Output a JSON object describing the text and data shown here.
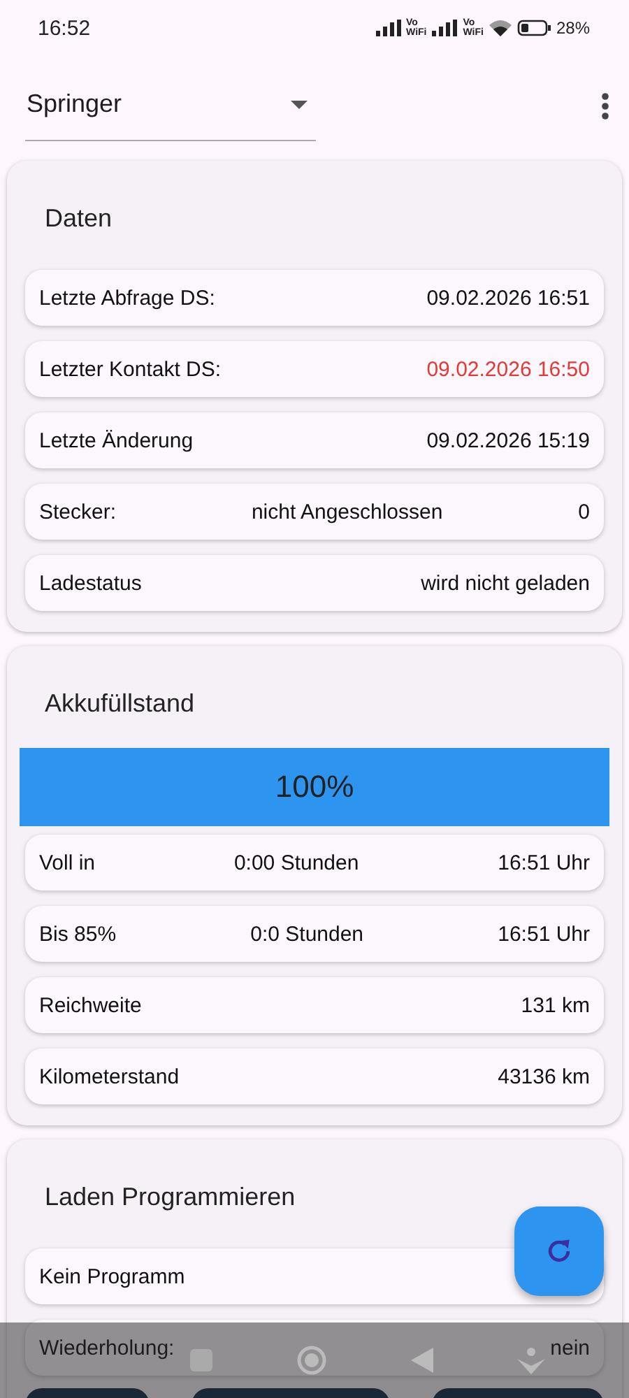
{
  "status_bar": {
    "time": "16:52",
    "network_labels": [
      {
        "top": "Vo",
        "bottom": "WiFi"
      },
      {
        "top": "Vo",
        "bottom": "WiFi"
      }
    ],
    "battery": "28%"
  },
  "header": {
    "vehicle": "Springer"
  },
  "data_card": {
    "title": "Daten",
    "rows": [
      {
        "label": "Letzte Abfrage DS:",
        "value": "09.02.2026 16:51",
        "alert": false
      },
      {
        "label": "Letzter Kontakt DS:",
        "value": "09.02.2026 16:50",
        "alert": true
      },
      {
        "label": "Letzte Änderung",
        "value": "09.02.2026 15:19",
        "alert": false
      },
      {
        "label": "Stecker:",
        "middle": "nicht Angeschlossen",
        "value": "0",
        "alert": false
      },
      {
        "label": "Ladestatus",
        "value": "wird nicht geladen",
        "alert": false
      }
    ]
  },
  "battery_card": {
    "title": "Akkufüllstand",
    "level": 1,
    "reading": "100%",
    "rows": [
      {
        "label": "Voll in",
        "middle": "0:00 Stunden",
        "value": "16:51 Uhr"
      },
      {
        "label": "Bis 85%",
        "middle": "0:0 Stunden",
        "value": "16:51 Uhr"
      },
      {
        "label": "Reichweite",
        "value": "131 km"
      },
      {
        "label": "Kilometerstand",
        "value": "43136 km"
      }
    ]
  },
  "program_card": {
    "title": "Laden Programmieren",
    "rows": [
      {
        "label": "Kein Programm"
      },
      {
        "label": "Wiederholung:",
        "value": "nein"
      }
    ]
  }
}
